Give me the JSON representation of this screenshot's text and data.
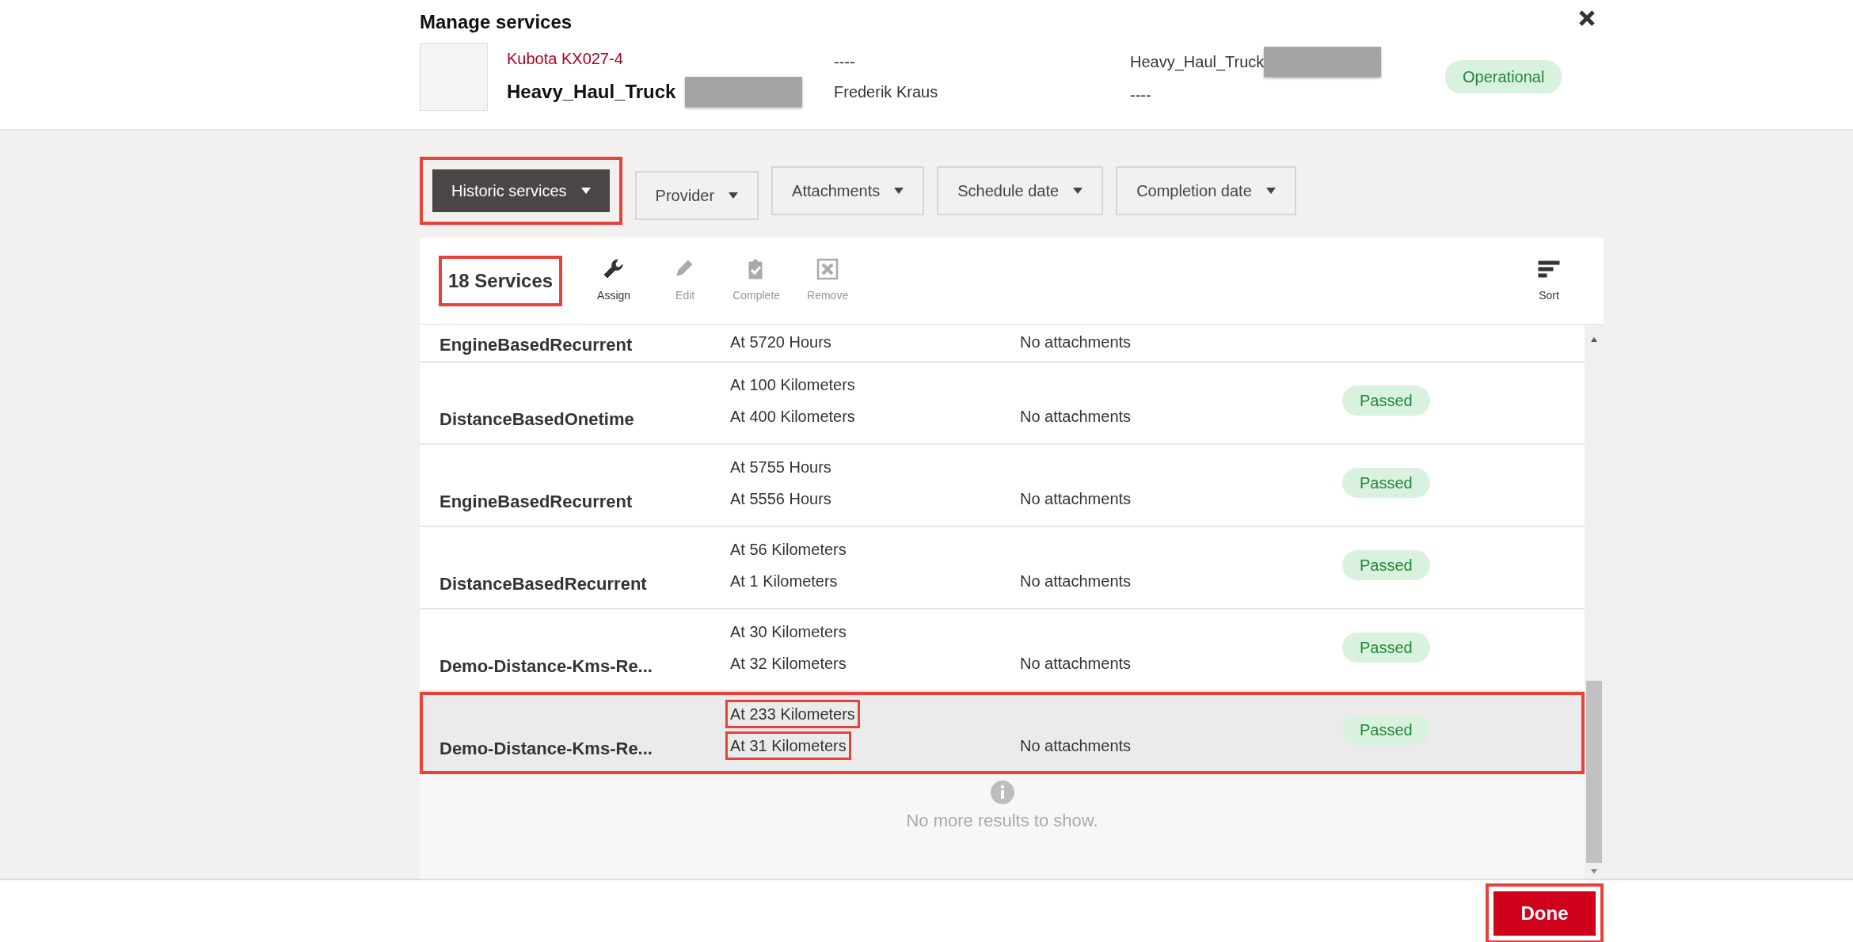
{
  "dialog": {
    "title": "Manage services"
  },
  "asset": {
    "model": "Kubota KX027-4",
    "name": "Heavy_Haul_Truck",
    "column_2_top": "----",
    "operator": "Frederik Kraus",
    "column_3_top": "Heavy_Haul_Truck",
    "column_3_bottom": "----",
    "status": "Operational"
  },
  "filters": [
    {
      "label": "Historic services",
      "selected": true,
      "highlighted": true
    },
    {
      "label": "Provider",
      "selected": false,
      "highlighted": false
    },
    {
      "label": "Attachments",
      "selected": false,
      "highlighted": false
    },
    {
      "label": "Schedule date",
      "selected": false,
      "highlighted": false
    },
    {
      "label": "Completion date",
      "selected": false,
      "highlighted": false
    }
  ],
  "toolbar": {
    "count": "18 Services",
    "count_highlighted": true,
    "actions": [
      {
        "label": "Assign",
        "kind": "wrench",
        "disabled": false
      },
      {
        "label": "Edit",
        "kind": "pencil",
        "disabled": true
      },
      {
        "label": "Complete",
        "kind": "clipboard",
        "disabled": true
      },
      {
        "label": "Remove",
        "kind": "remove",
        "disabled": true
      },
      {
        "label": "Sort",
        "kind": "sort",
        "disabled": false
      }
    ]
  },
  "rows": [
    {
      "name": "EngineBasedRecurrent",
      "schedule": [
        {
          "text": "At 5720 Hours",
          "highlighted": false
        }
      ],
      "attachments": "No attachments",
      "highlighted": false
    },
    {
      "name": "DistanceBasedOnetime",
      "schedule": [
        {
          "text": "At 100 Kilometers",
          "highlighted": false
        },
        {
          "text": "At 400 Kilometers",
          "highlighted": false
        }
      ],
      "attachments": "No attachments",
      "status": "Passed",
      "highlighted": false
    },
    {
      "name": "EngineBasedRecurrent",
      "schedule": [
        {
          "text": "At 5755 Hours",
          "highlighted": false
        },
        {
          "text": "At 5556 Hours",
          "highlighted": false
        }
      ],
      "attachments": "No attachments",
      "status": "Passed",
      "highlighted": false
    },
    {
      "name": "DistanceBasedRecurrent",
      "schedule": [
        {
          "text": "At 56 Kilometers",
          "highlighted": false
        },
        {
          "text": "At 1 Kilometers",
          "highlighted": false
        }
      ],
      "attachments": "No attachments",
      "status": "Passed",
      "highlighted": false
    },
    {
      "name": "Demo-Distance-Kms-Re...",
      "schedule": [
        {
          "text": "At 30 Kilometers",
          "highlighted": false
        },
        {
          "text": "At 32 Kilometers",
          "highlighted": false
        }
      ],
      "attachments": "No attachments",
      "status": "Passed",
      "highlighted": false
    },
    {
      "name": "Demo-Distance-Kms-Re...",
      "schedule": [
        {
          "text": "At 233 Kilometers",
          "highlighted": true
        },
        {
          "text": "At 31 Kilometers",
          "highlighted": true
        }
      ],
      "attachments": "No attachments",
      "status": "Passed",
      "highlighted": true
    }
  ],
  "end_message": "No more results to show.",
  "footer": {
    "done": "Done",
    "done_highlighted": true
  }
}
